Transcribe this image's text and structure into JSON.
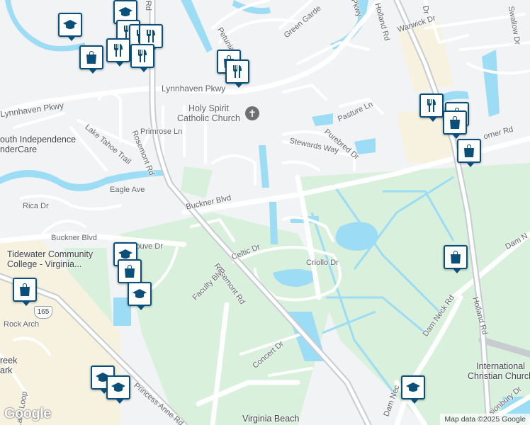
{
  "roads": [
    {
      "id": "lynnhaven-pkwy",
      "label": "Lynnhaven Pkwy"
    },
    {
      "id": "lynnhaven-pkwy-west",
      "label": "Lynnhaven Pkwy"
    },
    {
      "id": "rosemont-rd",
      "label": "Rosemont Rd"
    },
    {
      "id": "rosemont-rd-south",
      "label": "Rosemont Rd"
    },
    {
      "id": "holland-rd",
      "label": "Holland Rd"
    },
    {
      "id": "holland-rd-south",
      "label": "Holland Rd"
    },
    {
      "id": "dam-neck-rd",
      "label": "Dam Neck Rd"
    },
    {
      "id": "dam-neck-rd-east",
      "label": "Dam N"
    },
    {
      "id": "buckner-blvd",
      "label": "Buckner Blvd"
    },
    {
      "id": "buckner-blvd-west",
      "label": "Buckner Blvd"
    },
    {
      "id": "princess-anne-rd",
      "label": "Princess Anne Rd"
    },
    {
      "id": "faculty-blvd",
      "label": "Faculty Blvd"
    },
    {
      "id": "celtic-dr",
      "label": "Celtic Dr"
    },
    {
      "id": "criollo-dr",
      "label": "Criollo Dr"
    },
    {
      "id": "concert-dr",
      "label": "Concert Dr"
    },
    {
      "id": "stewards-way",
      "label": "Stewards Way"
    },
    {
      "id": "purebred-dr",
      "label": "Purebred Dr"
    },
    {
      "id": "pasture-ln",
      "label": "Pasture Ln"
    },
    {
      "id": "primrose-ln",
      "label": "Primrose Ln"
    },
    {
      "id": "lake-tahoe-trail",
      "label": "Lake Tahoe Trail"
    },
    {
      "id": "eagle-ave",
      "label": "Eagle Ave"
    },
    {
      "id": "rica-dr",
      "label": "Rica Dr"
    },
    {
      "id": "mabouve-dr",
      "label": "Mabouve Dr"
    },
    {
      "id": "rock-arch",
      "label": "Rock Arch"
    },
    {
      "id": "lake-loop",
      "label": "Lake Loop"
    },
    {
      "id": "green-garden",
      "label": "Green Garde"
    },
    {
      "id": "petunia",
      "label": "Petunia"
    },
    {
      "id": "warwick-dr",
      "label": "Warwick Dr"
    },
    {
      "id": "swallow-dr",
      "label": "Swallow Dr"
    },
    {
      "id": "corner-rd",
      "label": "orner Rd"
    },
    {
      "id": "dam-neck-south",
      "label": "Dam Nec"
    },
    {
      "id": "sionbury-dr",
      "label": "sionbury Dr"
    },
    {
      "id": "pkwy-top",
      "label": "Pkwy"
    },
    {
      "id": "rd-top",
      "label": "Rd"
    },
    {
      "id": "dr-top",
      "label": "Dr"
    }
  ],
  "places": [
    {
      "id": "holy-spirit",
      "label": "Holy Spirit\nCatholic Church"
    },
    {
      "id": "south-independence",
      "label": "outh Independence\nnderCare"
    },
    {
      "id": "tidewater",
      "label": "Tidewater Community\nCollege - Virginia..."
    },
    {
      "id": "international-christian",
      "label": "International\nChristian Church"
    },
    {
      "id": "virginia-beach",
      "label": "Virginia Beach"
    },
    {
      "id": "reek-ark",
      "label": "reek\nark"
    }
  ],
  "route_shield": "165",
  "pins": [
    {
      "type": "school",
      "icon": "graduation-cap-icon"
    },
    {
      "type": "school",
      "icon": "graduation-cap-icon"
    },
    {
      "type": "restaurant",
      "icon": "fork-knife-icon"
    },
    {
      "type": "restaurant",
      "icon": "fork-knife-icon"
    },
    {
      "type": "restaurant",
      "icon": "fork-knife-icon"
    },
    {
      "type": "shopping",
      "icon": "shopping-bag-icon"
    },
    {
      "type": "shopping",
      "icon": "shopping-bag-icon"
    },
    {
      "type": "restaurant",
      "icon": "fork-knife-icon"
    },
    {
      "type": "restaurant",
      "icon": "fork-knife-icon"
    },
    {
      "type": "restaurant",
      "icon": "fork-knife-icon"
    },
    {
      "type": "shopping",
      "icon": "shopping-bag-icon"
    },
    {
      "type": "restaurant",
      "icon": "fork-knife-icon"
    },
    {
      "type": "shopping",
      "icon": "shopping-bag-icon"
    },
    {
      "type": "shopping",
      "icon": "shopping-bag-icon"
    },
    {
      "type": "school",
      "icon": "graduation-cap-icon"
    },
    {
      "type": "shopping",
      "icon": "shopping-bag-icon"
    },
    {
      "type": "school",
      "icon": "graduation-cap-icon"
    },
    {
      "type": "shopping",
      "icon": "shopping-bag-icon"
    },
    {
      "type": "shopping",
      "icon": "shopping-bag-icon"
    },
    {
      "type": "school",
      "icon": "graduation-cap-icon"
    },
    {
      "type": "school",
      "icon": "graduation-cap-icon"
    },
    {
      "type": "school",
      "icon": "graduation-cap-icon"
    }
  ],
  "colors": {
    "water": "#9cdcf4",
    "park": "#d8f0dc",
    "road": "#ffffff",
    "highway": "#c8ccd0",
    "pin_border": "#0a4f7a",
    "land": "#f1f3f4"
  },
  "logo": "Google",
  "attribution": "Map data ©2025 Google"
}
